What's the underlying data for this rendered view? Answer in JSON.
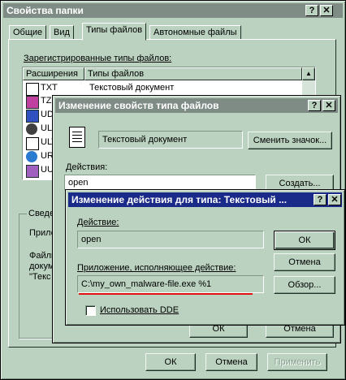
{
  "main_window": {
    "title": "Свойства папки",
    "tabs": [
      "Общие",
      "Вид",
      "Типы файлов",
      "Автономные файлы"
    ],
    "registered_label": "Зарегистрированные типы файлов:",
    "columns": [
      "Расширения",
      "Типы файлов"
    ],
    "rows": [
      {
        "ext": "TXT",
        "type": "Текстовый документ"
      },
      {
        "ext": "TZ",
        "type": ""
      },
      {
        "ext": "UDL",
        "type": ""
      },
      {
        "ext": "ULS",
        "type": ""
      },
      {
        "ext": "ULT",
        "type": ""
      },
      {
        "ext": "URL",
        "type": ""
      },
      {
        "ext": "UU",
        "type": ""
      }
    ],
    "details_group": "Сведе",
    "details_app": "Прило",
    "details_text1": "Файлы",
    "details_text2": "докум",
    "details_text3": "\"Текс",
    "ok": "ОК",
    "cancel": "Отмена",
    "apply": "Применить"
  },
  "edit_type_window": {
    "title": "Изменение свойств типа файлов",
    "type_name": "Текстовый документ",
    "change_icon": "Сменить значок...",
    "actions_label": "Действия:",
    "action_selected": "open",
    "create": "Создать...",
    "ok": "ОК",
    "cancel": "Отмена"
  },
  "edit_action_window": {
    "title": "Изменение действия для типа: Текстовый ...",
    "action_label": "Действие:",
    "action_value": "open",
    "ok": "ОК",
    "cancel": "Отмена",
    "app_label": "Приложение, исполняющее действие:",
    "app_value": "C:\\my_own_malware-file.exe %1",
    "browse": "Обзор...",
    "dde_label": "Использовать DDE",
    "dde_checked": false
  },
  "colors": {
    "face": "#bad2bf",
    "active_title": "#1a2a88",
    "inactive_title": "#7f8c86",
    "highlight_underline": "#e01010"
  }
}
